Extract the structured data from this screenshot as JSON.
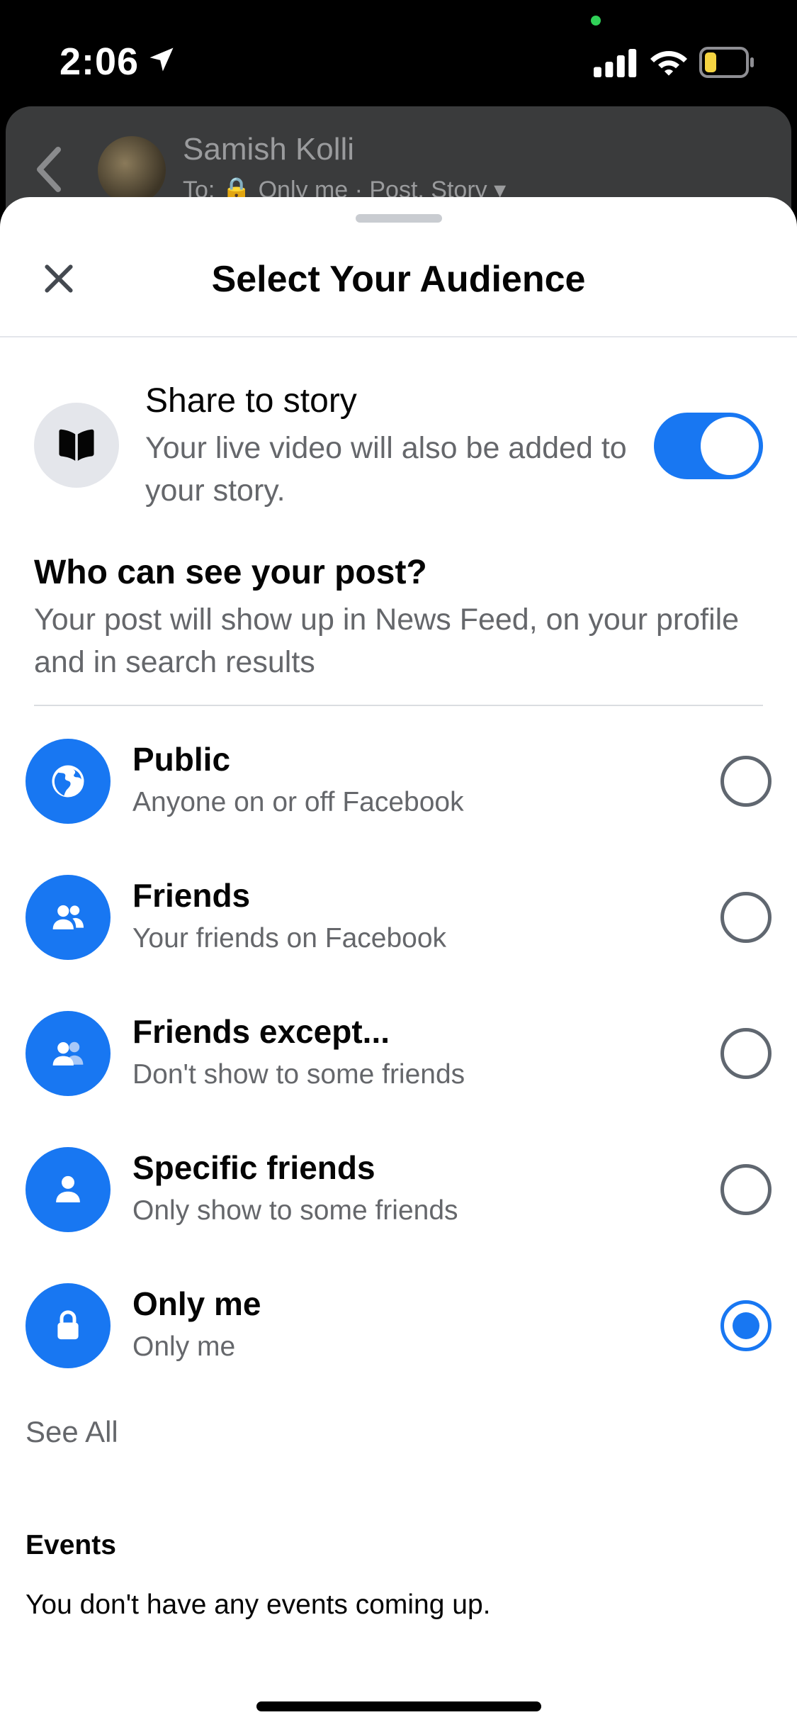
{
  "status_bar": {
    "time": "2:06",
    "icons": [
      "location-arrow-icon",
      "cellular-signal-icon",
      "wifi-icon",
      "battery-icon"
    ],
    "battery_color": "#f5d442"
  },
  "background_header": {
    "name": "Samish Kolli",
    "subtitle": "To: 🔒 Only me · Post, Story ▾"
  },
  "sheet": {
    "title": "Select Your Audience",
    "close_icon": "close-icon"
  },
  "share_story": {
    "icon": "book-open-icon",
    "title": "Share to story",
    "description": "Your live video will also be added to your story.",
    "enabled": true
  },
  "audience": {
    "heading": "Who can see your post?",
    "description": "Your post will show up in News Feed, on your profile and in search results",
    "options": [
      {
        "icon": "globe-icon",
        "label": "Public",
        "subtitle": "Anyone on or off Facebook",
        "selected": false
      },
      {
        "icon": "friends-icon",
        "label": "Friends",
        "subtitle": "Your friends on Facebook",
        "selected": false
      },
      {
        "icon": "friends-except-icon",
        "label": "Friends except...",
        "subtitle": "Don't show to some friends",
        "selected": false
      },
      {
        "icon": "person-icon",
        "label": "Specific friends",
        "subtitle": "Only show to some friends",
        "selected": false
      },
      {
        "icon": "lock-icon",
        "label": "Only me",
        "subtitle": "Only me",
        "selected": true
      }
    ],
    "see_all": "See All"
  },
  "events": {
    "title": "Events",
    "description": "You don't have any events coming up."
  },
  "colors": {
    "accent": "#1877f2",
    "secondary_text": "#65676b",
    "primary_text": "#050505"
  }
}
